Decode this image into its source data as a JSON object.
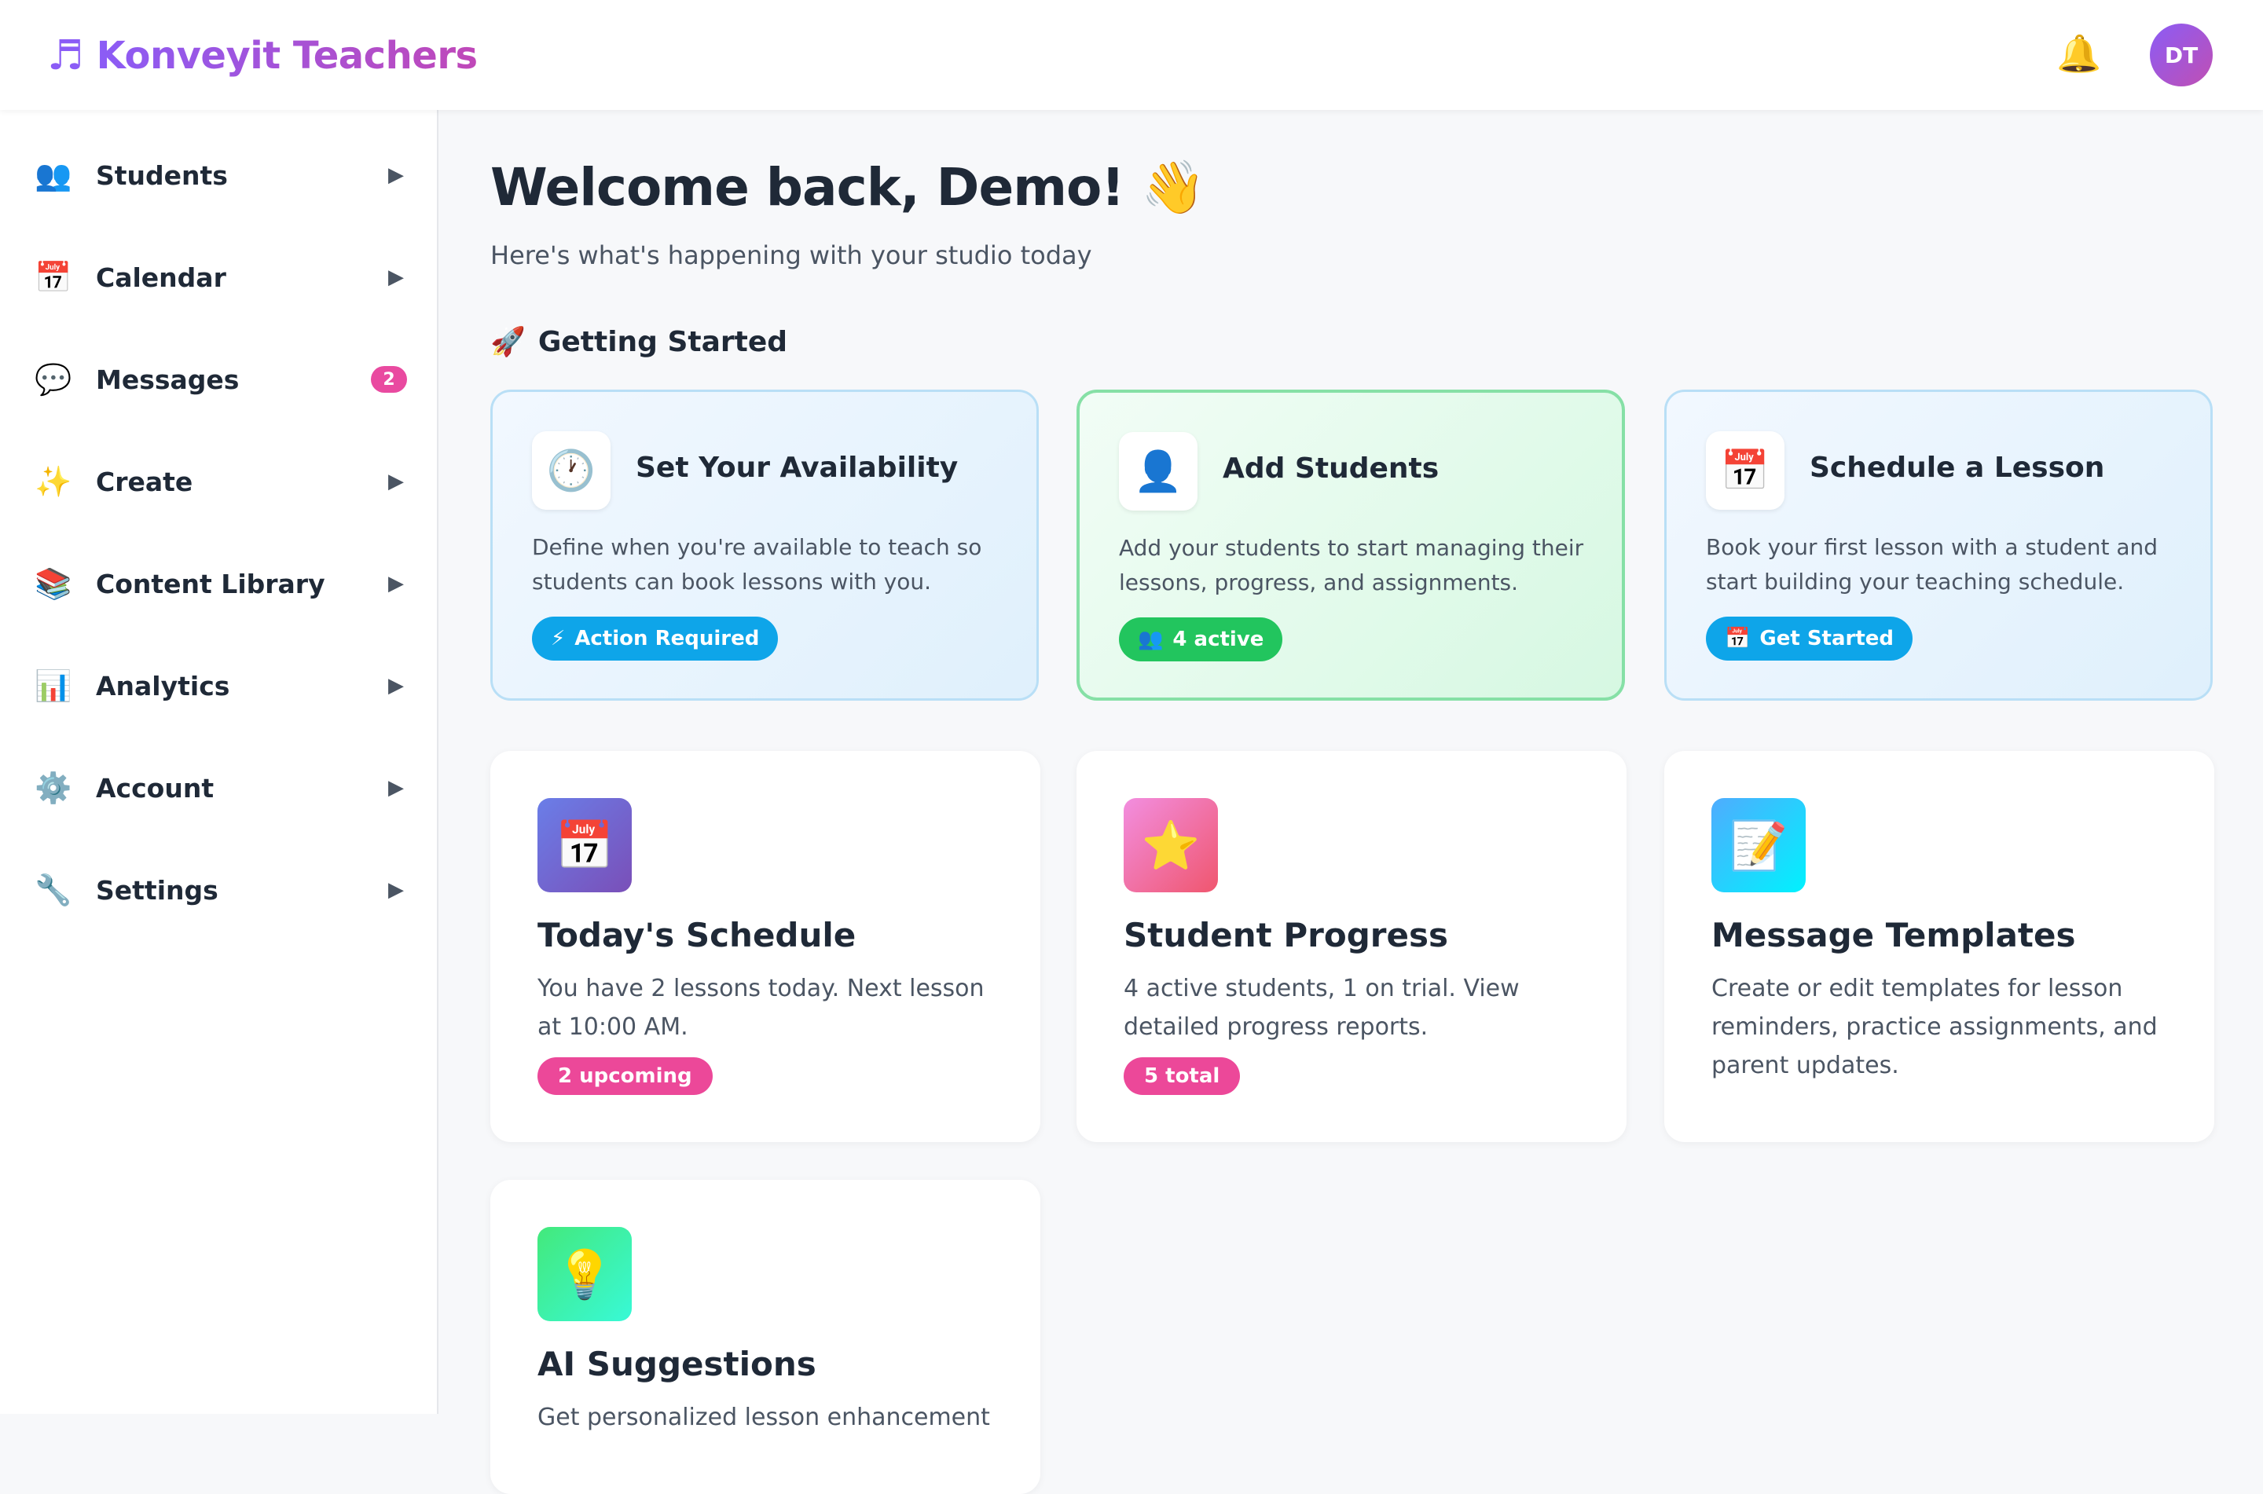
{
  "header": {
    "brand_icon": "♬",
    "brand_name": "Konveyit Teachers",
    "bell_icon": "🔔",
    "avatar_initials": "DT"
  },
  "sidebar": {
    "items": [
      {
        "icon": "👥",
        "label": "Students",
        "arrow": "▶"
      },
      {
        "icon": "📅",
        "label": "Calendar",
        "arrow": "▶"
      },
      {
        "icon": "💬",
        "label": "Messages",
        "badge": "2"
      },
      {
        "icon": "✨",
        "label": "Create",
        "arrow": "▶"
      },
      {
        "icon": "📚",
        "label": "Content Library",
        "arrow": "▶"
      },
      {
        "icon": "📊",
        "label": "Analytics",
        "arrow": "▶"
      },
      {
        "icon": "⚙️",
        "label": "Account",
        "arrow": "▶"
      },
      {
        "icon": "🔧",
        "label": "Settings",
        "arrow": "▶"
      }
    ]
  },
  "main": {
    "welcome": "Welcome back, Demo! 👋",
    "subtitle": "Here's what's happening with your studio today",
    "getting_started": {
      "icon": "🚀",
      "title": "Getting Started",
      "cards": [
        {
          "icon": "🕐",
          "title": "Set Your Availability",
          "description": "Define when you're available to teach so students can book lessons with you.",
          "pill_icon": "⚡",
          "pill_label": "Action Required"
        },
        {
          "icon": "👤",
          "title": "Add Students",
          "description": "Add your students to start managing their lessons, progress, and assignments.",
          "pill_icon": "👥",
          "pill_label": "4 active"
        },
        {
          "icon": "📅",
          "title": "Schedule a Lesson",
          "description": "Book your first lesson with a student and start building your teaching schedule.",
          "pill_icon": "📅",
          "pill_label": "Get Started"
        }
      ]
    },
    "features": [
      {
        "icon": "📅",
        "title": "Today's Schedule",
        "description": "You have 2 lessons today. Next lesson at 10:00 AM.",
        "pill": "2 upcoming"
      },
      {
        "icon": "⭐",
        "title": "Student Progress",
        "description": "4 active students, 1 on trial. View detailed progress reports.",
        "pill": "5 total"
      },
      {
        "icon": "📝",
        "title": "Message Templates",
        "description": "Create or edit templates for lesson reminders, practice assignments, and parent updates."
      },
      {
        "icon": "💡",
        "title": "AI Suggestions",
        "description": "Get personalized lesson enhancement"
      }
    ]
  },
  "colors": {
    "brand_purple": "#8b5cf6",
    "brand_pink": "#c048b8",
    "badge_pink": "#e94aa0",
    "pill_blue": "#0ea5e9",
    "pill_green": "#22c55e",
    "pill_pink": "#ec4899"
  }
}
